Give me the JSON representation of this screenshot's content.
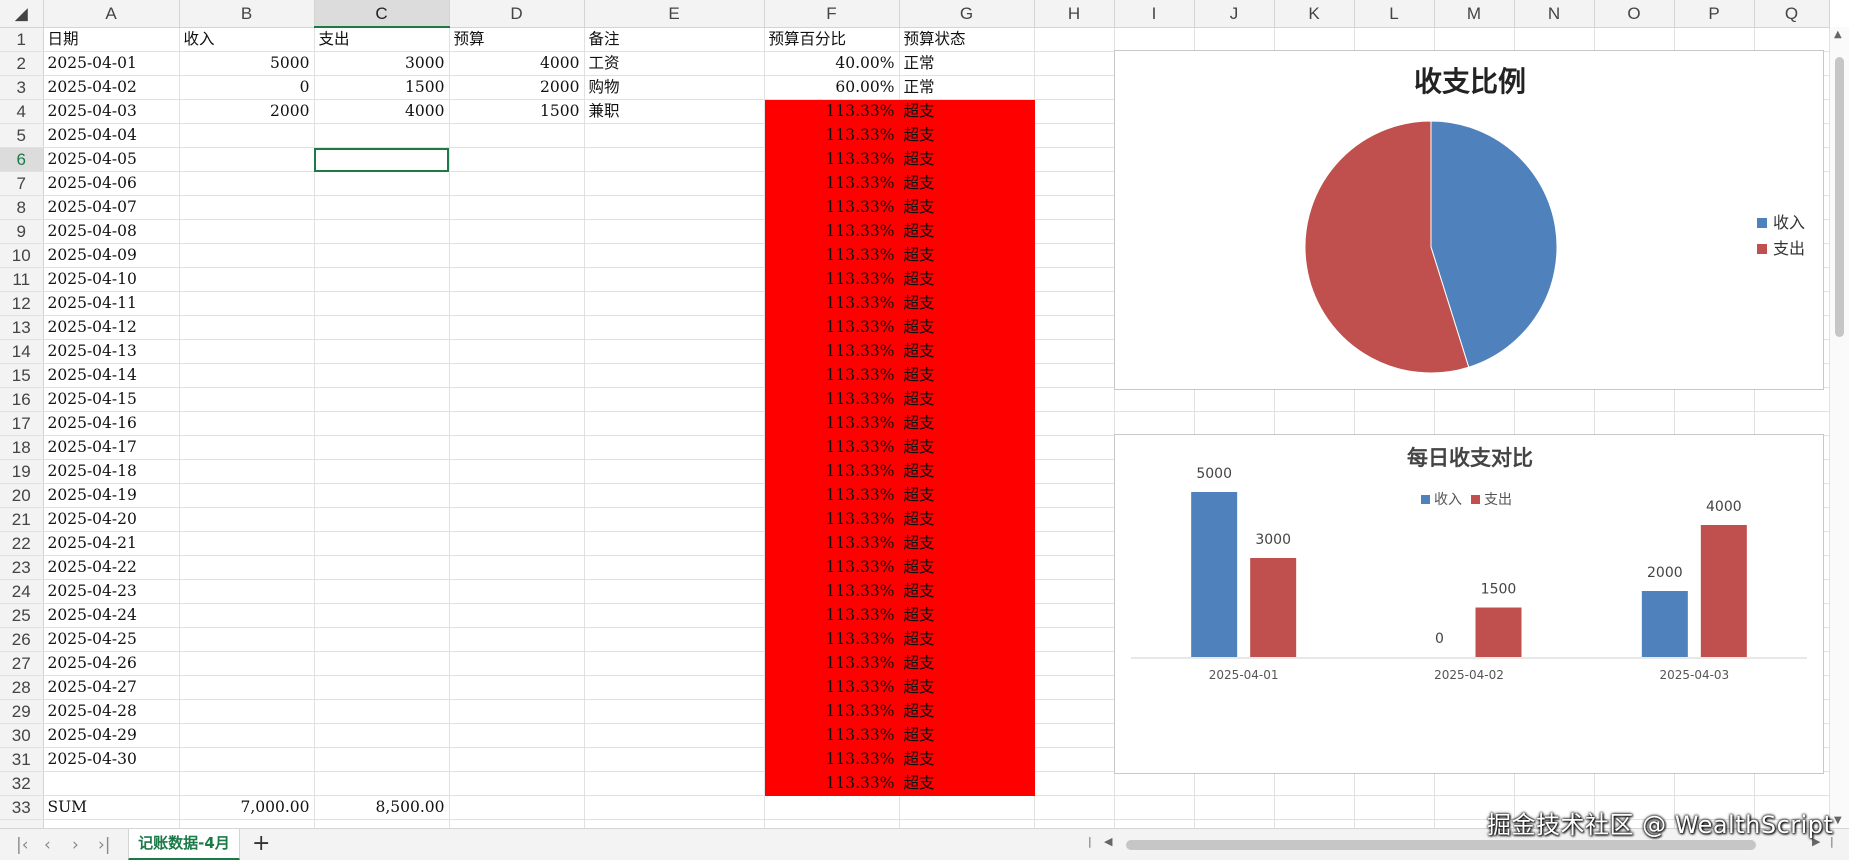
{
  "columns": [
    "A",
    "B",
    "C",
    "D",
    "E",
    "F",
    "G",
    "H",
    "I",
    "J",
    "K",
    "L",
    "M",
    "N",
    "O",
    "P",
    "Q"
  ],
  "rows": [
    {
      "n": "1",
      "cells": [
        "日期",
        "收入",
        "支出",
        "预算",
        "备注",
        "预算百分比",
        "预算状态"
      ]
    },
    {
      "n": "2",
      "cells": [
        "2025-04-01",
        "5000",
        "3000",
        "4000",
        "工资",
        "40.00%",
        "正常"
      ]
    },
    {
      "n": "3",
      "cells": [
        "2025-04-02",
        "0",
        "1500",
        "2000",
        "购物",
        "60.00%",
        "正常"
      ]
    },
    {
      "n": "4",
      "cells": [
        "2025-04-03",
        "2000",
        "4000",
        "1500",
        "兼职",
        "113.33%",
        "超支"
      ]
    },
    {
      "n": "5",
      "cells": [
        "2025-04-04",
        "",
        "",
        "",
        "",
        "113.33%",
        "超支"
      ]
    },
    {
      "n": "6",
      "cells": [
        "2025-04-05",
        "",
        "",
        "",
        "",
        "113.33%",
        "超支"
      ]
    },
    {
      "n": "7",
      "cells": [
        "2025-04-06",
        "",
        "",
        "",
        "",
        "113.33%",
        "超支"
      ]
    },
    {
      "n": "8",
      "cells": [
        "2025-04-07",
        "",
        "",
        "",
        "",
        "113.33%",
        "超支"
      ]
    },
    {
      "n": "9",
      "cells": [
        "2025-04-08",
        "",
        "",
        "",
        "",
        "113.33%",
        "超支"
      ]
    },
    {
      "n": "10",
      "cells": [
        "2025-04-09",
        "",
        "",
        "",
        "",
        "113.33%",
        "超支"
      ]
    },
    {
      "n": "11",
      "cells": [
        "2025-04-10",
        "",
        "",
        "",
        "",
        "113.33%",
        "超支"
      ]
    },
    {
      "n": "12",
      "cells": [
        "2025-04-11",
        "",
        "",
        "",
        "",
        "113.33%",
        "超支"
      ]
    },
    {
      "n": "13",
      "cells": [
        "2025-04-12",
        "",
        "",
        "",
        "",
        "113.33%",
        "超支"
      ]
    },
    {
      "n": "14",
      "cells": [
        "2025-04-13",
        "",
        "",
        "",
        "",
        "113.33%",
        "超支"
      ]
    },
    {
      "n": "15",
      "cells": [
        "2025-04-14",
        "",
        "",
        "",
        "",
        "113.33%",
        "超支"
      ]
    },
    {
      "n": "16",
      "cells": [
        "2025-04-15",
        "",
        "",
        "",
        "",
        "113.33%",
        "超支"
      ]
    },
    {
      "n": "17",
      "cells": [
        "2025-04-16",
        "",
        "",
        "",
        "",
        "113.33%",
        "超支"
      ]
    },
    {
      "n": "18",
      "cells": [
        "2025-04-17",
        "",
        "",
        "",
        "",
        "113.33%",
        "超支"
      ]
    },
    {
      "n": "19",
      "cells": [
        "2025-04-18",
        "",
        "",
        "",
        "",
        "113.33%",
        "超支"
      ]
    },
    {
      "n": "20",
      "cells": [
        "2025-04-19",
        "",
        "",
        "",
        "",
        "113.33%",
        "超支"
      ]
    },
    {
      "n": "21",
      "cells": [
        "2025-04-20",
        "",
        "",
        "",
        "",
        "113.33%",
        "超支"
      ]
    },
    {
      "n": "22",
      "cells": [
        "2025-04-21",
        "",
        "",
        "",
        "",
        "113.33%",
        "超支"
      ]
    },
    {
      "n": "23",
      "cells": [
        "2025-04-22",
        "",
        "",
        "",
        "",
        "113.33%",
        "超支"
      ]
    },
    {
      "n": "24",
      "cells": [
        "2025-04-23",
        "",
        "",
        "",
        "",
        "113.33%",
        "超支"
      ]
    },
    {
      "n": "25",
      "cells": [
        "2025-04-24",
        "",
        "",
        "",
        "",
        "113.33%",
        "超支"
      ]
    },
    {
      "n": "26",
      "cells": [
        "2025-04-25",
        "",
        "",
        "",
        "",
        "113.33%",
        "超支"
      ]
    },
    {
      "n": "27",
      "cells": [
        "2025-04-26",
        "",
        "",
        "",
        "",
        "113.33%",
        "超支"
      ]
    },
    {
      "n": "28",
      "cells": [
        "2025-04-27",
        "",
        "",
        "",
        "",
        "113.33%",
        "超支"
      ]
    },
    {
      "n": "29",
      "cells": [
        "2025-04-28",
        "",
        "",
        "",
        "",
        "113.33%",
        "超支"
      ]
    },
    {
      "n": "30",
      "cells": [
        "2025-04-29",
        "",
        "",
        "",
        "",
        "113.33%",
        "超支"
      ]
    },
    {
      "n": "31",
      "cells": [
        "2025-04-30",
        "",
        "",
        "",
        "",
        "113.33%",
        "超支"
      ]
    },
    {
      "n": "32",
      "cells": [
        "",
        "",
        "",
        "",
        "",
        "113.33%",
        "超支"
      ]
    },
    {
      "n": "33",
      "cells": [
        "SUM",
        "7,000.00",
        "8,500.00",
        "",
        "",
        "",
        ""
      ]
    }
  ],
  "selection": {
    "cell": "C6",
    "column": "C",
    "row": "6"
  },
  "colors": {
    "accent": "#1b7a47",
    "overbudget_fill": "#ff0000",
    "income": "#4f81bd",
    "expense": "#c0504d"
  },
  "sheet_tabs": {
    "active": "记账数据-4月",
    "add_label": "+"
  },
  "nav_icons": [
    "first-sheet-icon",
    "prev-sheet-icon",
    "next-sheet-icon",
    "last-sheet-icon"
  ],
  "watermark": "掘金技术社区 @ WealthScript",
  "chart_data": [
    {
      "type": "pie",
      "title": "收支比例",
      "categories": [
        "收入",
        "支出"
      ],
      "values": [
        7000,
        8500
      ],
      "colors": [
        "#4f81bd",
        "#c0504d"
      ],
      "legend": "right"
    },
    {
      "type": "bar",
      "title": "每日收支对比",
      "categories": [
        "2025-04-01",
        "2025-04-02",
        "2025-04-03"
      ],
      "series": [
        {
          "name": "收入",
          "values": [
            5000,
            0,
            2000
          ],
          "color": "#4f81bd"
        },
        {
          "name": "支出",
          "values": [
            3000,
            1500,
            4000
          ],
          "color": "#c0504d"
        }
      ],
      "legend": "top",
      "data_labels": true,
      "grid": false
    }
  ]
}
